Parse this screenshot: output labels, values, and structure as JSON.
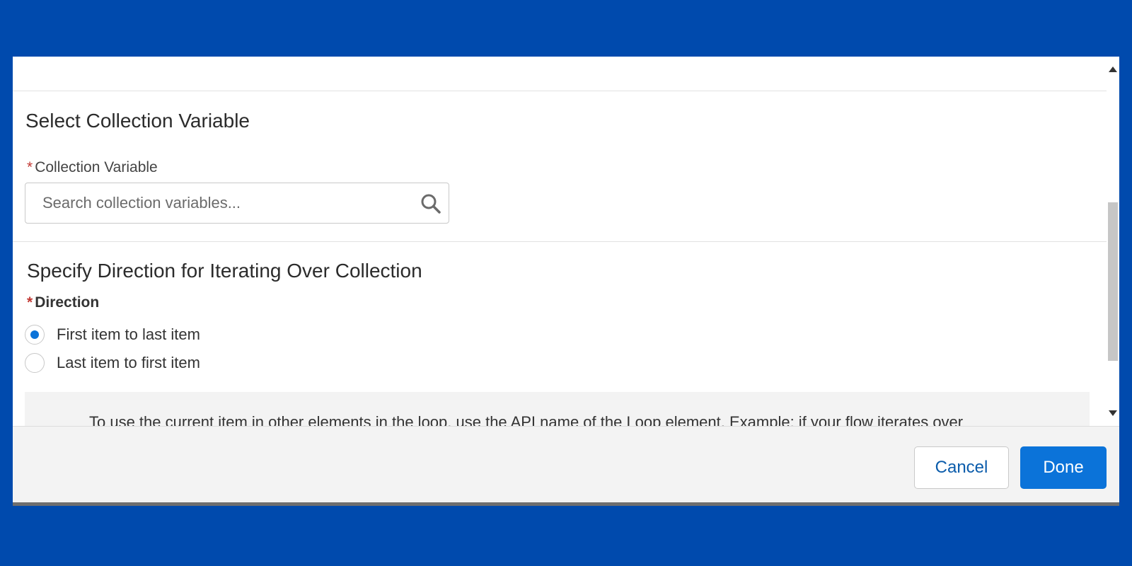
{
  "colors": {
    "background": "#004aad",
    "accent": "#0b73d9",
    "required": "#c23934"
  },
  "collection_section": {
    "title": "Select Collection Variable",
    "field_label": "Collection Variable",
    "required_marker": "*",
    "search_placeholder": "Search collection variables...",
    "search_value": "",
    "icon": "search-icon"
  },
  "direction_section": {
    "title": "Specify Direction for Iterating Over Collection",
    "field_label": "Direction",
    "required_marker": "*",
    "options": [
      {
        "label": "First item to last item",
        "checked": true
      },
      {
        "label": "Last item to first item",
        "checked": false
      }
    ]
  },
  "info": {
    "text": "To use the current item in other elements in the loop, use the API name of the Loop element. Example: if your flow iterates over"
  },
  "footer": {
    "cancel_label": "Cancel",
    "done_label": "Done"
  }
}
